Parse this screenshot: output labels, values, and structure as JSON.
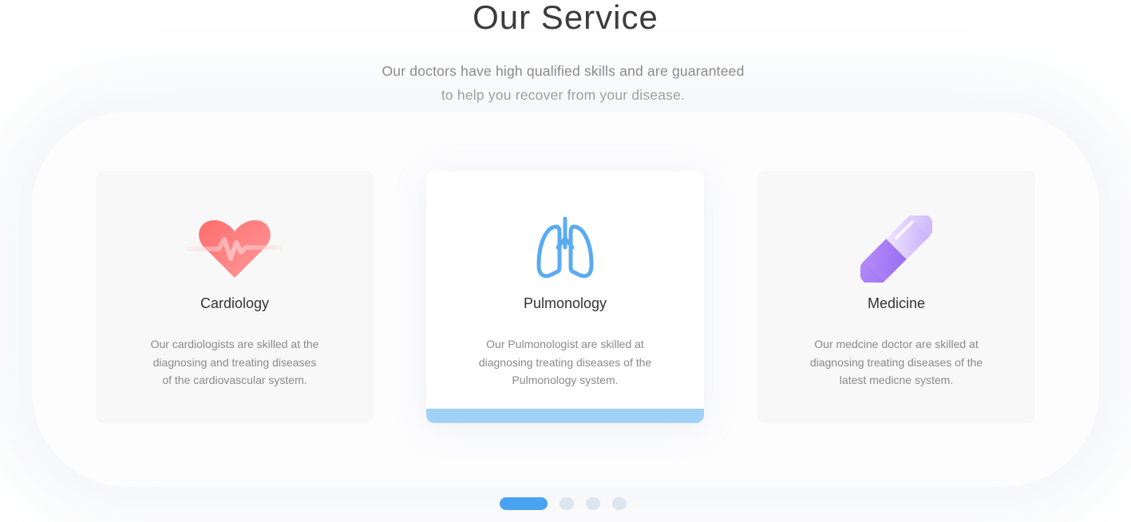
{
  "section": {
    "title": "Our Service",
    "subtitle_lines": [
      "Our doctors have high qualified skills and are guaranteed",
      "to help you recover from your disease."
    ]
  },
  "cards": [
    {
      "icon": "heart-pulse-icon",
      "name": "Cardiology",
      "desc_lines": [
        "Our cardiologists are skilled at  the",
        "diagnosing and treating diseases",
        "of the cardiovascular system."
      ],
      "accent": "#ff7b7b"
    },
    {
      "icon": "lungs-icon",
      "name": "Pulmonology",
      "desc_lines": [
        "Our Pulmonologist are skilled at",
        "diagnosing treating diseases of the",
        "Pulmonology system."
      ],
      "accent": "#5aabf0"
    },
    {
      "icon": "pill-capsule-icon",
      "name": "Medicine",
      "desc_lines": [
        "Our medcine doctor are skilled at",
        "diagnosing treating diseases of the",
        "latest medicne system."
      ],
      "accent": "#a57cf5"
    }
  ],
  "carousel": {
    "total_pages": 4,
    "current_page": 1,
    "active_color": "#4aa3f1",
    "inactive_color": "#dce6ee"
  }
}
